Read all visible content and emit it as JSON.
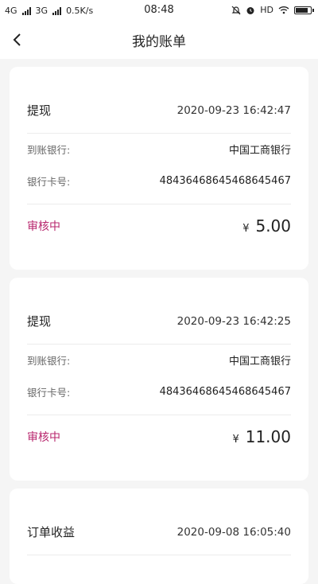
{
  "statusbar": {
    "net1": "4G",
    "net2": "3G",
    "speed": "0.5K/s",
    "time": "08:48",
    "hd": "HD"
  },
  "header": {
    "title": "我的账单",
    "back_icon": "chevron-left-icon"
  },
  "labels": {
    "bank": "到账银行:",
    "card": "银行卡号:"
  },
  "bills": [
    {
      "type": "提现",
      "time": "2020-09-23 16:42:47",
      "bank": "中国工商银行",
      "card": "48436468645468645467",
      "status": "审核中",
      "currency": "¥",
      "amount": "5.00"
    },
    {
      "type": "提现",
      "time": "2020-09-23 16:42:25",
      "bank": "中国工商银行",
      "card": "48436468645468645467",
      "status": "审核中",
      "currency": "¥",
      "amount": "11.00"
    },
    {
      "type": "订单收益",
      "time": "2020-09-08 16:05:40"
    }
  ],
  "colors": {
    "status": "#b8276e",
    "background": "#f5f5f5"
  }
}
